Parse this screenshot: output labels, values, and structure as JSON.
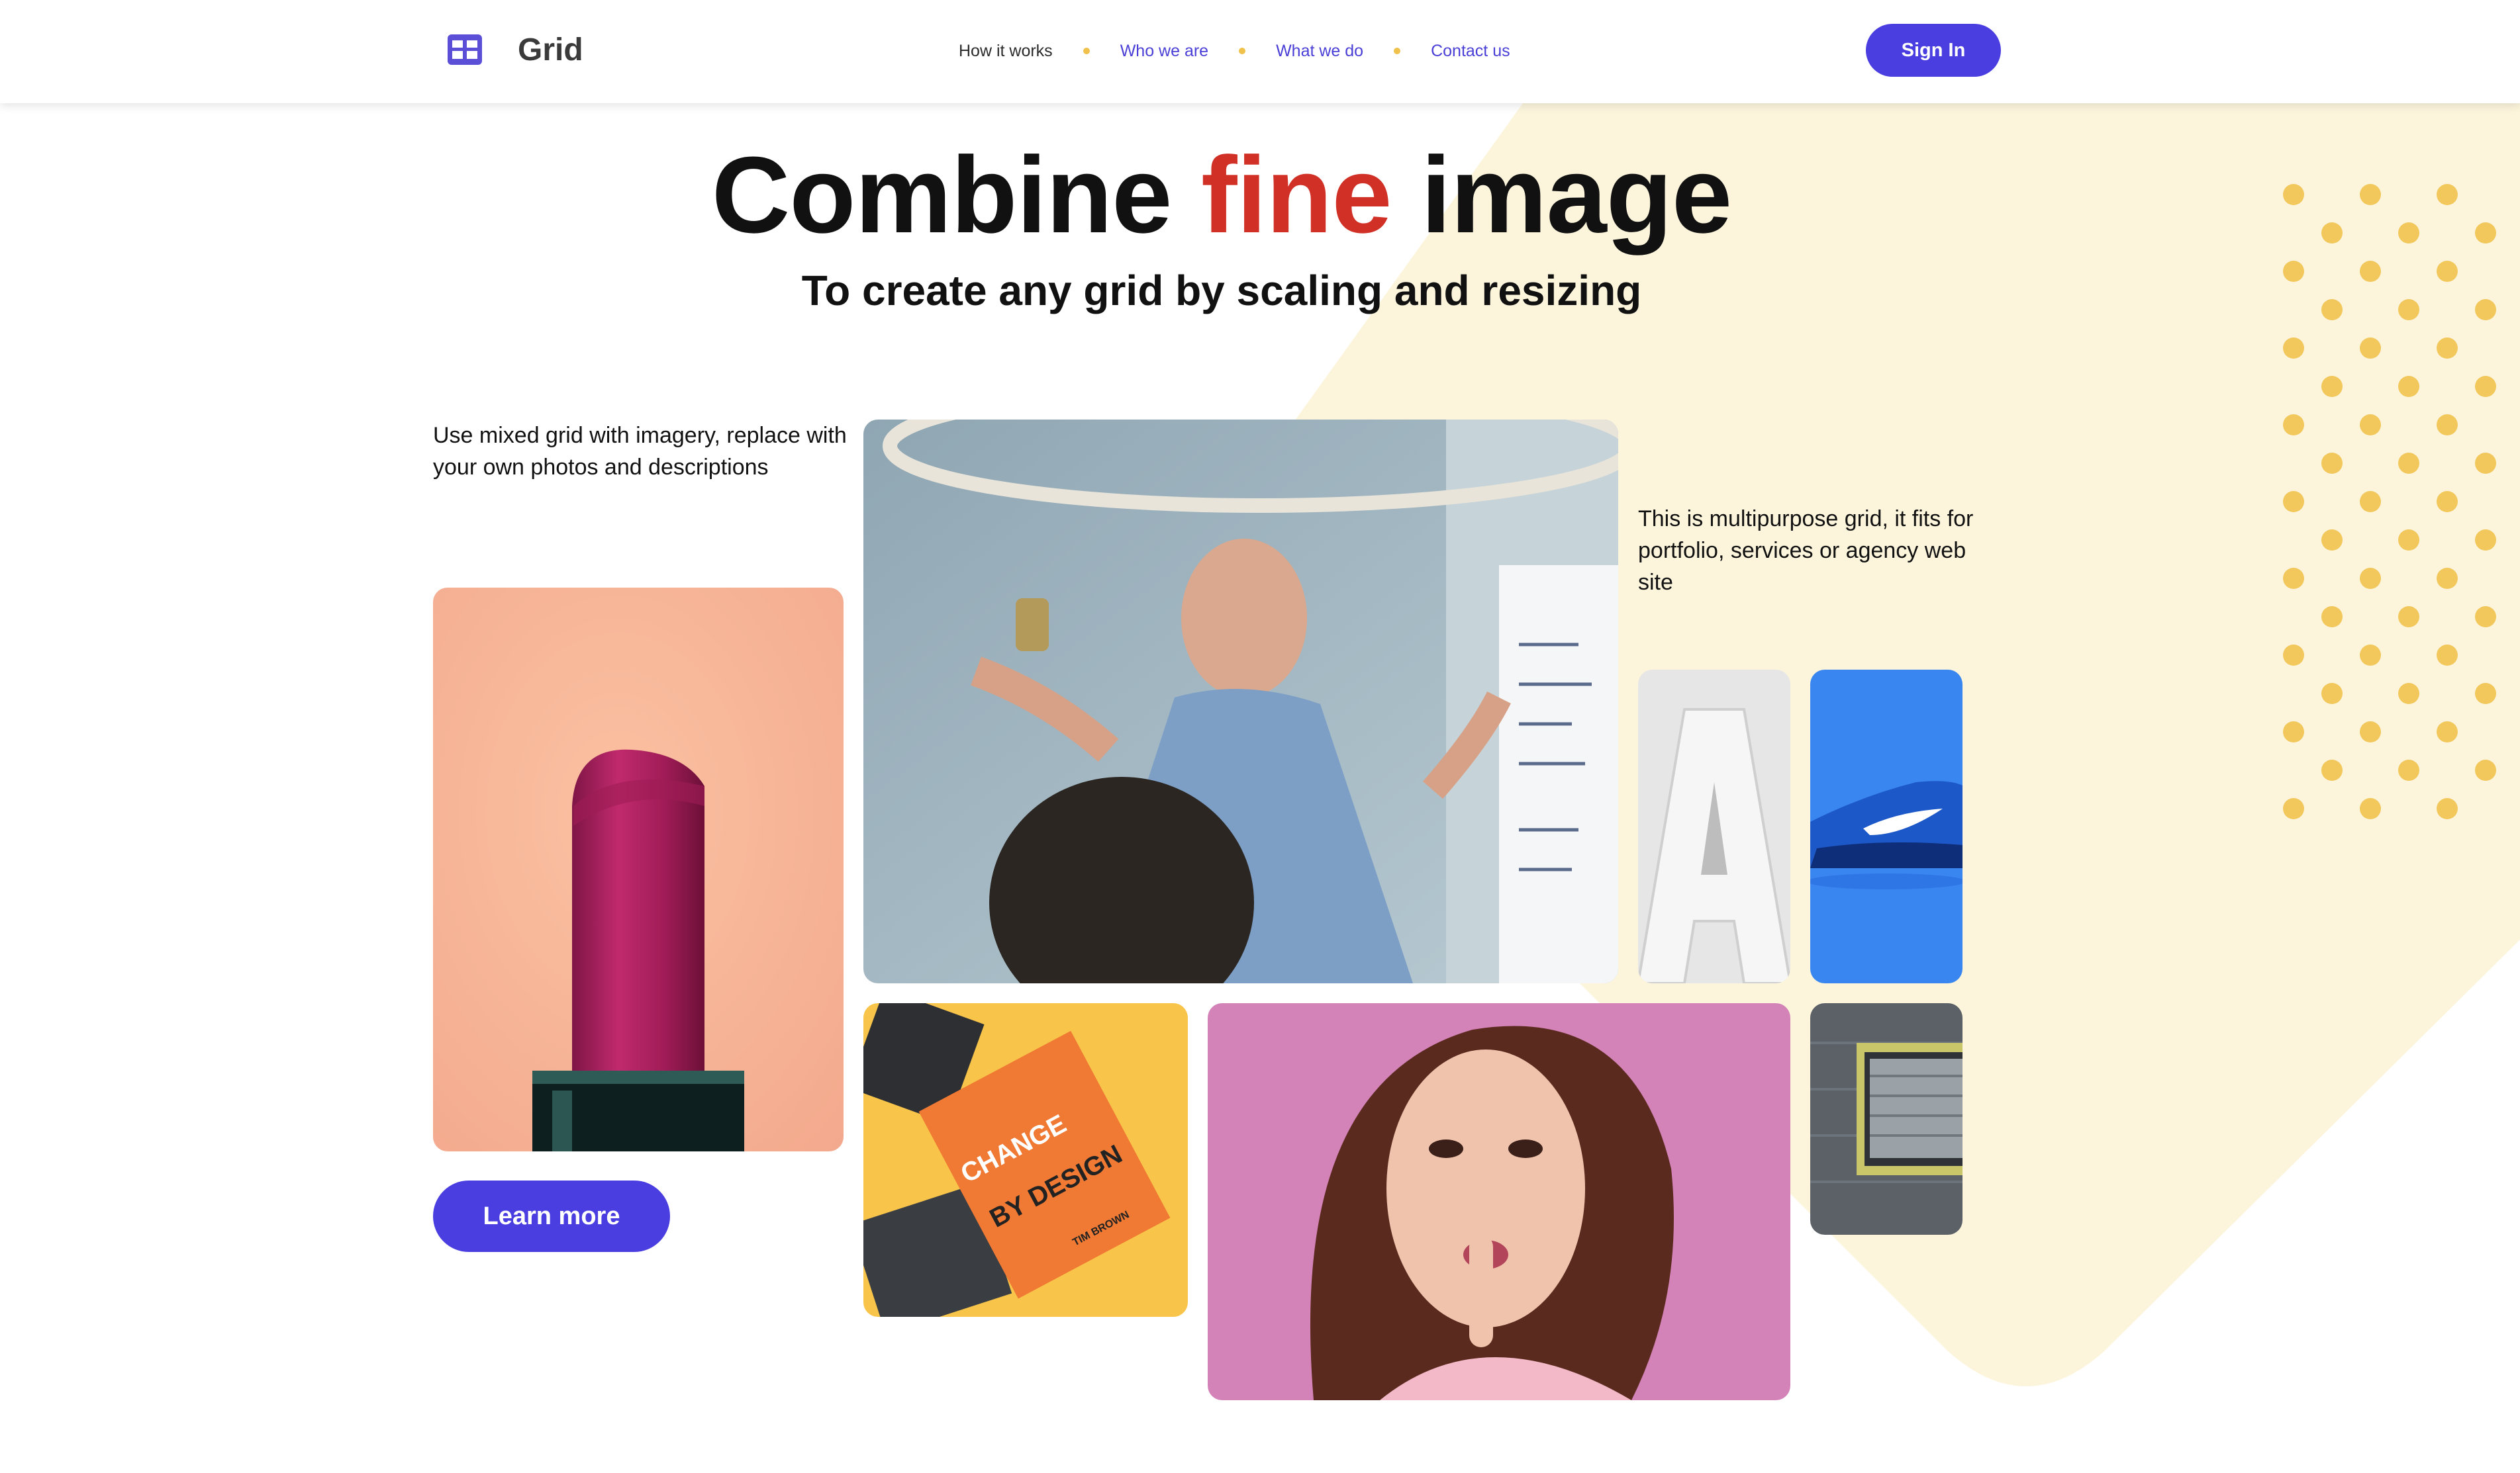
{
  "header": {
    "logo_text": "Grid",
    "nav": [
      {
        "label": "How it works",
        "active": true
      },
      {
        "label": "Who we are",
        "active": false
      },
      {
        "label": "What we do",
        "active": false
      },
      {
        "label": "Contact us",
        "active": false
      }
    ],
    "signin_label": "Sign In"
  },
  "hero": {
    "title_before": "Combine ",
    "title_accent": "fine",
    "title_after": " image",
    "subtitle": "To create any grid by scaling and resizing"
  },
  "content": {
    "left_text": "Use mixed grid with imagery, replace with your own photos and descriptions",
    "right_text": "This is multipurpose grid, it fits for portfolio, services or agency web site",
    "learn_more_label": "Learn more"
  },
  "images": {
    "book_title_line1": "CHANGE",
    "book_title_line2": "BY DESIGN",
    "book_author": "TIM BROWN",
    "letter": "A"
  },
  "colors": {
    "accent": "#4a3ee0",
    "highlight": "#d03026",
    "nav_dot": "#f0c14b",
    "background_shape": "#fcf5dc",
    "dots": "#f2c75c"
  },
  "icons": [
    "grid-logo-icon"
  ]
}
